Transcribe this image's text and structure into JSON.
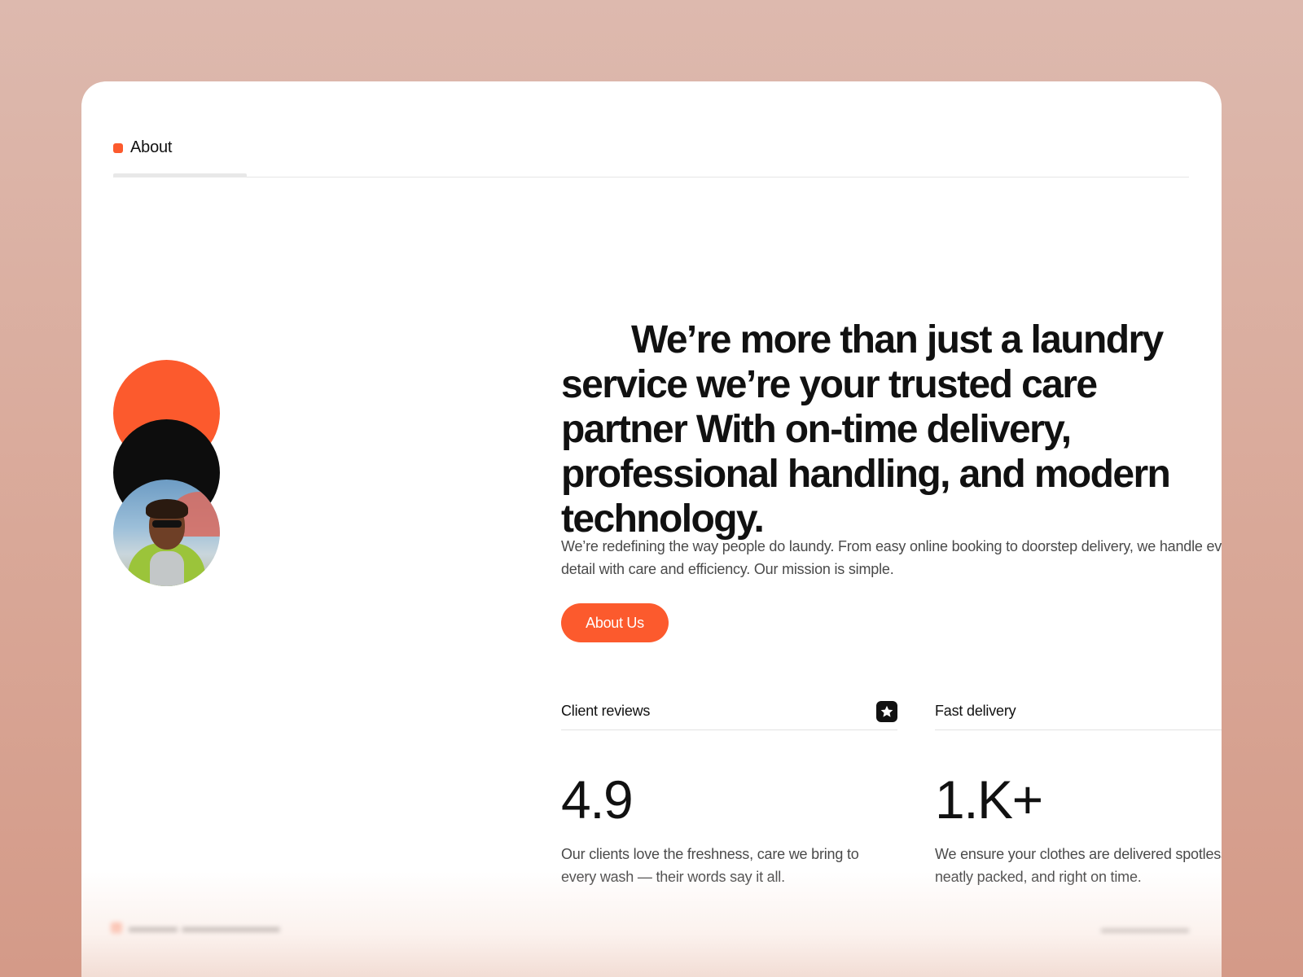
{
  "section": {
    "label": "About",
    "accent": "#fc5a2d"
  },
  "hero": {
    "headline": "We’re more than just a laundry service we’re your trusted care partner With on-time delivery, professional handling, and modern technology.",
    "intro": "We’re redefining the way people do laundy. From easy online booking to doorstep delivery, we handle every detail with care and efficiency. Our mission is simple.",
    "cta_label": "About Us"
  },
  "stats": [
    {
      "label": "Client reviews",
      "icon": "star-icon",
      "value": "4.9",
      "description": "Our clients love the freshness, care we bring to every wash — their words say it all."
    },
    {
      "label": "Fast delivery",
      "icon": "lightning-icon",
      "value": "1.K+",
      "description": "We ensure your clothes are delivered spotless, neatly packed, and right on time."
    }
  ],
  "avatar_stack": {
    "colors": [
      "#fc5a2d",
      "#0d0d0d"
    ],
    "photo": "person-photo"
  }
}
